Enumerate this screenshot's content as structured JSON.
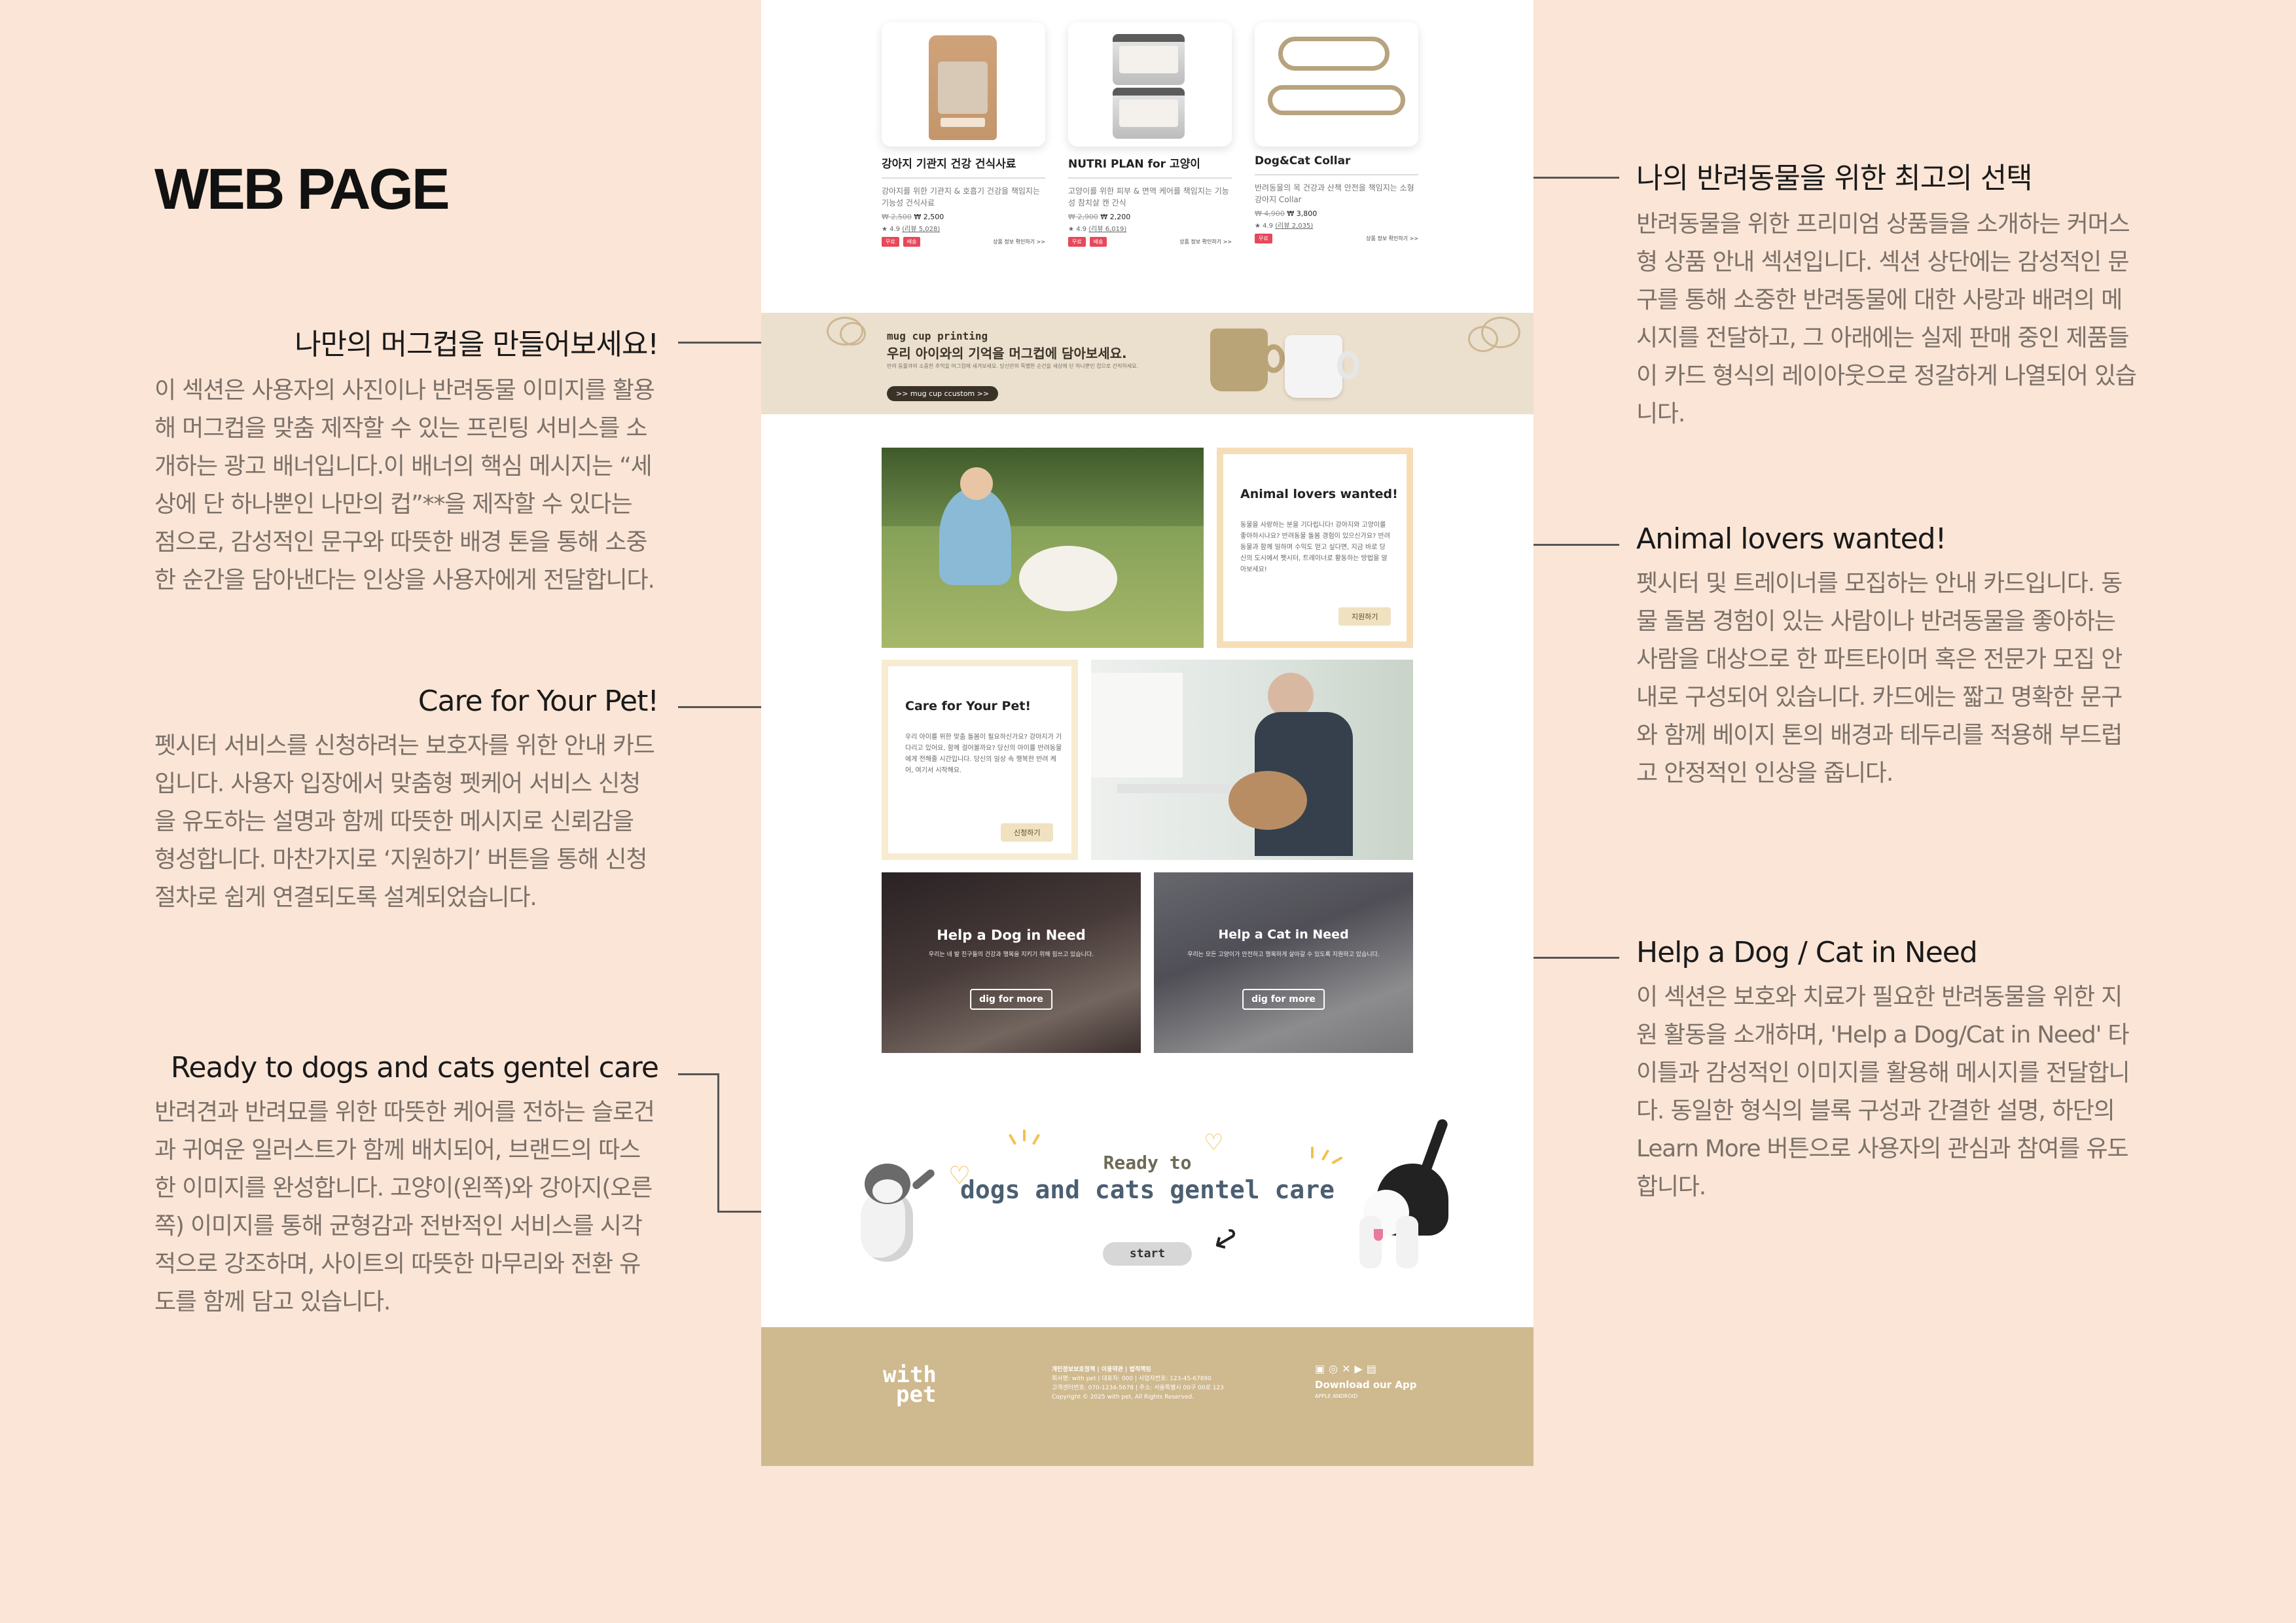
{
  "page_title": "WEB PAGE",
  "annotations": {
    "mug": {
      "title": "나만의 머그컵을 만들어보세요!",
      "body": "이 섹션은 사용자의 사진이나 반려동물 이미지를 활용해 머그컵을 맞춤 제작할 수 있는 프린팅 서비스를 소개하는 광고 배너입니다.이 배너의 핵심 메시지는 “세상에 단 하나뿐인 나만의 컵”**을 제작할 수 있다는 점으로, 감성적인 문구와 따뜻한 배경 톤을 통해 소중한 순간을 담아낸다는 인상을 사용자에게 전달합니다."
    },
    "care": {
      "title": "Care for Your Pet!",
      "body": "펫시터 서비스를 신청하려는 보호자를 위한 안내 카드입니다. 사용자 입장에서 맞춤형 펫케어 서비스 신청을 유도하는 설명과 함께 따뜻한 메시지로 신뢰감을 형성합니다. 마찬가지로 ‘지원하기’ 버튼을 통해 신청 절차로 쉽게 연결되도록 설계되었습니다."
    },
    "ready": {
      "title": "Ready to dogs and cats gentel care",
      "body": "반려견과 반려묘를 위한 따뜻한 케어를 전하는 슬로건과 귀여운 일러스트가 함께 배치되어, 브랜드의 따스한 이미지를 완성합니다. 고양이(왼쪽)와 강아지(오른쪽) 이미지를 통해 균형감과 전반적인 서비스를 시각적으로 강조하며, 사이트의 따뜻한 마무리와 전환 유도를 함께 담고 있습니다."
    },
    "best": {
      "title": "나의 반려동물을 위한 최고의 선택",
      "body": "반려동물을 위한 프리미엄 상품들을 소개하는 커머스형 상품 안내 섹션입니다. 섹션 상단에는 감성적인 문구를 통해 소중한 반려동물에 대한 사랑과 배려의 메시지를 전달하고, 그 아래에는 실제 판매 중인 제품들이 카드 형식의 레이아웃으로 정갈하게 나열되어 있습니다."
    },
    "lovers": {
      "title": "Animal lovers wanted!",
      "body": "펫시터 및 트레이너를 모집하는 안내 카드입니다. 동물 돌봄 경험이 있는 사람이나 반려동물을 좋아하는 사람을 대상으로 한 파트타이머 혹은 전문가 모집 안내로 구성되어 있습니다. 카드에는 짧고 명확한 문구와 함께 베이지 톤의 배경과 테두리를 적용해 부드럽고 안정적인 인상을 줍니다."
    },
    "help": {
      "title": "Help a Dog / Cat in Need",
      "body": "이 섹션은 보호와 치료가 필요한 반려동물을 위한 지원 활동을 소개하며, 'Help a Dog/Cat in Need' 타이틀과 감성적인 이미지를 활용해 메시지를 전달합니다. 동일한 형식의 블록 구성과 간결한 설명, 하단의 Learn More 버튼으로 사용자의 관심과 참여를 유도합니다."
    }
  },
  "products": [
    {
      "name": "강아지 기관지 건강 건식사료",
      "desc": "강아지를 위한 기관지 & 호흡기 건강을 책임지는 기능성 건식사료",
      "old_price": "₩ 2,500",
      "price": "₩ 2,500",
      "rating": "★ 4.9",
      "reviews": "(리뷰 5,028)",
      "tag1": "무료",
      "tag2": "배송",
      "more": "상품 정보 확인하기 >>"
    },
    {
      "name": "NUTRI PLAN for 고양이",
      "desc": "고양이를 위한 피부 & 면역 케어를 책임지는 기능성 참치살 캔 간식",
      "old_price": "₩ 2,900",
      "price": "₩ 2,200",
      "rating": "★ 4.9",
      "reviews": "(리뷰 6,019)",
      "tag1": "무료",
      "tag2": "배송",
      "more": "상품 정보 확인하기 >>"
    },
    {
      "name": "Dog&Cat Collar",
      "desc": "반려동물의 목 건강과 산책 안전을 책임지는 소형 강아지 Collar",
      "old_price": "₩ 4,900",
      "price": "₩ 3,800",
      "rating": "★ 4.9",
      "reviews": "(리뷰 2,035)",
      "tag1": "무료",
      "tag2": "",
      "more": "상품 정보 확인하기 >>"
    }
  ],
  "mug_banner": {
    "eyebrow": "mug cup printing",
    "headline": "우리 아이와의 기억을 머그컵에 담아보세요.",
    "body": "반려 동물과의 소중한 추억을 머그컵에 새겨보세요. 당신만의 특별한 순간을 세상에 단 하나뿐인 컵으로 간직하세요.",
    "button": ">> mug cup ccustom >>"
  },
  "lovers_card": {
    "title": "Animal lovers wanted!",
    "body": "동물을 사랑하는 분을 기다립니다! 강아지와 고양이를 좋아하시나요? 반려동물 돌봄 경험이 있으신가요? 반려동물과 함께 일하며 수익도 얻고 싶다면, 지금 바로 당신의 도시에서 펫시터, 트레이너로 활동하는 방법을 알아보세요!",
    "button": "지원하기"
  },
  "care_card": {
    "title": "Care for Your Pet!",
    "body": "우리 아이를 위한 맞춤 돌봄이 필요하신가요? 강아지가 기다리고 있어요, 함께 걸어볼까요? 당신의 아이를 반려동물에게 전해줄 시간입니다. 당신의 일상 속 행복한 반려 케어, 여기서 시작해요.",
    "button": "신청하기"
  },
  "help_dog": {
    "title": "Help a Dog in Need",
    "subtitle": "우리는 네 발 친구들의 건강과 행복을 지키기 위해 힘쓰고 있습니다.",
    "button": "dig for more"
  },
  "help_cat": {
    "title": "Help a Cat in Need",
    "subtitle": "우리는 모든 고양이가 안전하고 행복하게 살아갈 수 있도록 지원하고 있습니다.",
    "button": "dig for more"
  },
  "ready": {
    "line1": "Ready to",
    "line2": "dogs and cats gentel care",
    "button": "start"
  },
  "footer": {
    "logo_top": "with",
    "logo_bottom": "pet",
    "links_row1": "개인정보보호정책 | 이용약관 | 법적책임",
    "links_row2": "회사명: with pet | 대표자: 000 | 사업자번호: 123-45-67890",
    "links_row3": "고객센터번호: 070-1234-5678 | 주소: 서울특별시 00구 00로 123",
    "copyright": "Copyright © 2025 with pet, All Rights Reserved.",
    "download": "Download our App",
    "os": "APPLE   ANDROID"
  },
  "colors": {
    "background": "#fbe5d6",
    "banner": "#ebdfce",
    "footer": "#cfb98f",
    "card_border": "#f5deb7",
    "tag": "#e7485a"
  }
}
